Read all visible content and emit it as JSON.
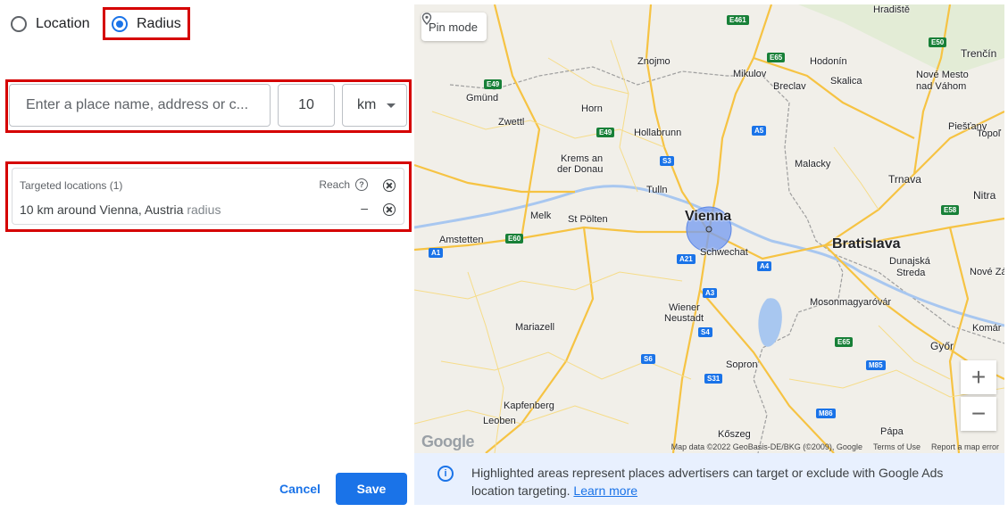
{
  "radio": {
    "location_label": "Location",
    "radius_label": "Radius",
    "selected": "Radius"
  },
  "inputs": {
    "place_placeholder": "Enter a place name, address or c...",
    "radius_value": "10",
    "unit": "km"
  },
  "targeted": {
    "header": "Targeted locations (1)",
    "reach_label": "Reach",
    "item_text": "10 km around Vienna, Austria",
    "item_type": "radius",
    "item_reach": "–"
  },
  "actions": {
    "cancel": "Cancel",
    "save": "Save"
  },
  "map": {
    "pin_mode": "Pin mode",
    "zoom_in": "+",
    "zoom_out": "−",
    "google": "Google",
    "attribution": "Map data ©2022 GeoBasis-DE/BKG (©2009), Google",
    "terms": "Terms of Use",
    "report": "Report a map error",
    "cities": {
      "hradiste": "Hradiště",
      "trencin": "Trenčín",
      "znojmo": "Znojmo",
      "mikulov": "Mikulov",
      "hodonin": "Hodonín",
      "skalica": "Skalica",
      "nove_mesto": "Nové Mesto",
      "nad_vahom": "nad Váhom",
      "gmund": "Gmünd",
      "horn": "Horn",
      "breclav": "Breclav",
      "zwettl": "Zwettl",
      "hollabrunn": "Hollabrunn",
      "piestany": "Piešťany",
      "topol": "Topoľ",
      "krems1": "Krems an",
      "krems2": "der Donau",
      "malacky": "Malacky",
      "trnava": "Trnava",
      "tulln": "Tulln",
      "nitra": "Nitra",
      "melk": "Melk",
      "st_polten": "St Pölten",
      "vienna": "Vienna",
      "amstetten": "Amstetten",
      "schwechat": "Schwechat",
      "bratislava": "Bratislava",
      "dunajska1": "Dunajská",
      "dunajska2": "Streda",
      "nove_zam": "Nové Zá",
      "wiener1": "Wiener",
      "wiener2": "Neustadt",
      "mosonmagyarovar": "Mosonmagyaróvár",
      "mariazell": "Mariazell",
      "komar": "Komár",
      "gyor": "Győr",
      "sopron": "Sopron",
      "kapfenberg": "Kapfenberg",
      "leoben": "Leoben",
      "papa": "Pápa",
      "koszeg": "Kőszeg"
    },
    "shields": {
      "e461": "E461",
      "e65a": "E65",
      "e50": "E50",
      "e49": "E49",
      "e49b": "E49",
      "a5": "A5",
      "s3": "S3",
      "e60": "E60",
      "a1": "A1",
      "a21": "A21",
      "a4": "A4",
      "a3": "A3",
      "s4": "S4",
      "s6": "S6",
      "s31": "S31",
      "e65b": "E65",
      "m85": "M85",
      "m86": "M86",
      "e58": "E58"
    }
  },
  "info": {
    "text": "Highlighted areas represent places advertisers can target or exclude with Google Ads location targeting.",
    "link": "Learn more"
  },
  "colors": {
    "accent": "#1a73e8",
    "highlight_border": "#d50000",
    "radius_fill": "#7b9ff0",
    "info_bg": "#e8f0fe"
  }
}
